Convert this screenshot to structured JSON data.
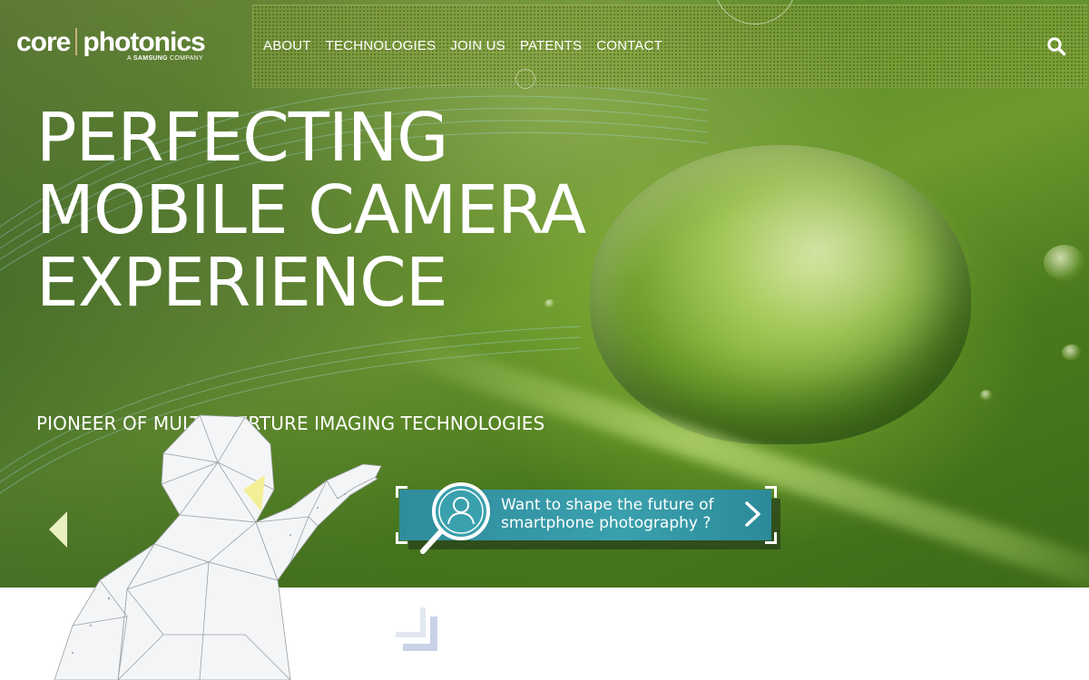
{
  "brand": {
    "name_part1": "core",
    "name_part2": "photonics",
    "tagline_prefix": "A",
    "tagline_brand": "SAMSUNG",
    "tagline_suffix": "COMPANY"
  },
  "nav": {
    "items": [
      {
        "label": "ABOUT"
      },
      {
        "label": "TECHNOLOGIES"
      },
      {
        "label": "JOIN US"
      },
      {
        "label": "PATENTS"
      },
      {
        "label": "CONTACT"
      }
    ],
    "search_icon": "search-icon"
  },
  "hero": {
    "headline_line1": "PERFECTING",
    "headline_line2": "MOBILE CAMERA",
    "headline_line3": "EXPERIENCE",
    "subtitle": "PIONEER OF MULTI-APERTURE IMAGING TECHNOLOGIES",
    "cta_line1": "Want to shape the future of",
    "cta_line2": "smartphone photography ?",
    "cta_icon": "person-magnifier-icon",
    "cta_arrow_icon": "chevron-right-icon",
    "prev_icon": "triangle-left-icon"
  },
  "colors": {
    "cta_teal": "#3aa0ad",
    "prev_arrow": "#e8f0c0",
    "logo_separator": "#c9b27a",
    "bottom_deco": "#c9d2e6"
  }
}
